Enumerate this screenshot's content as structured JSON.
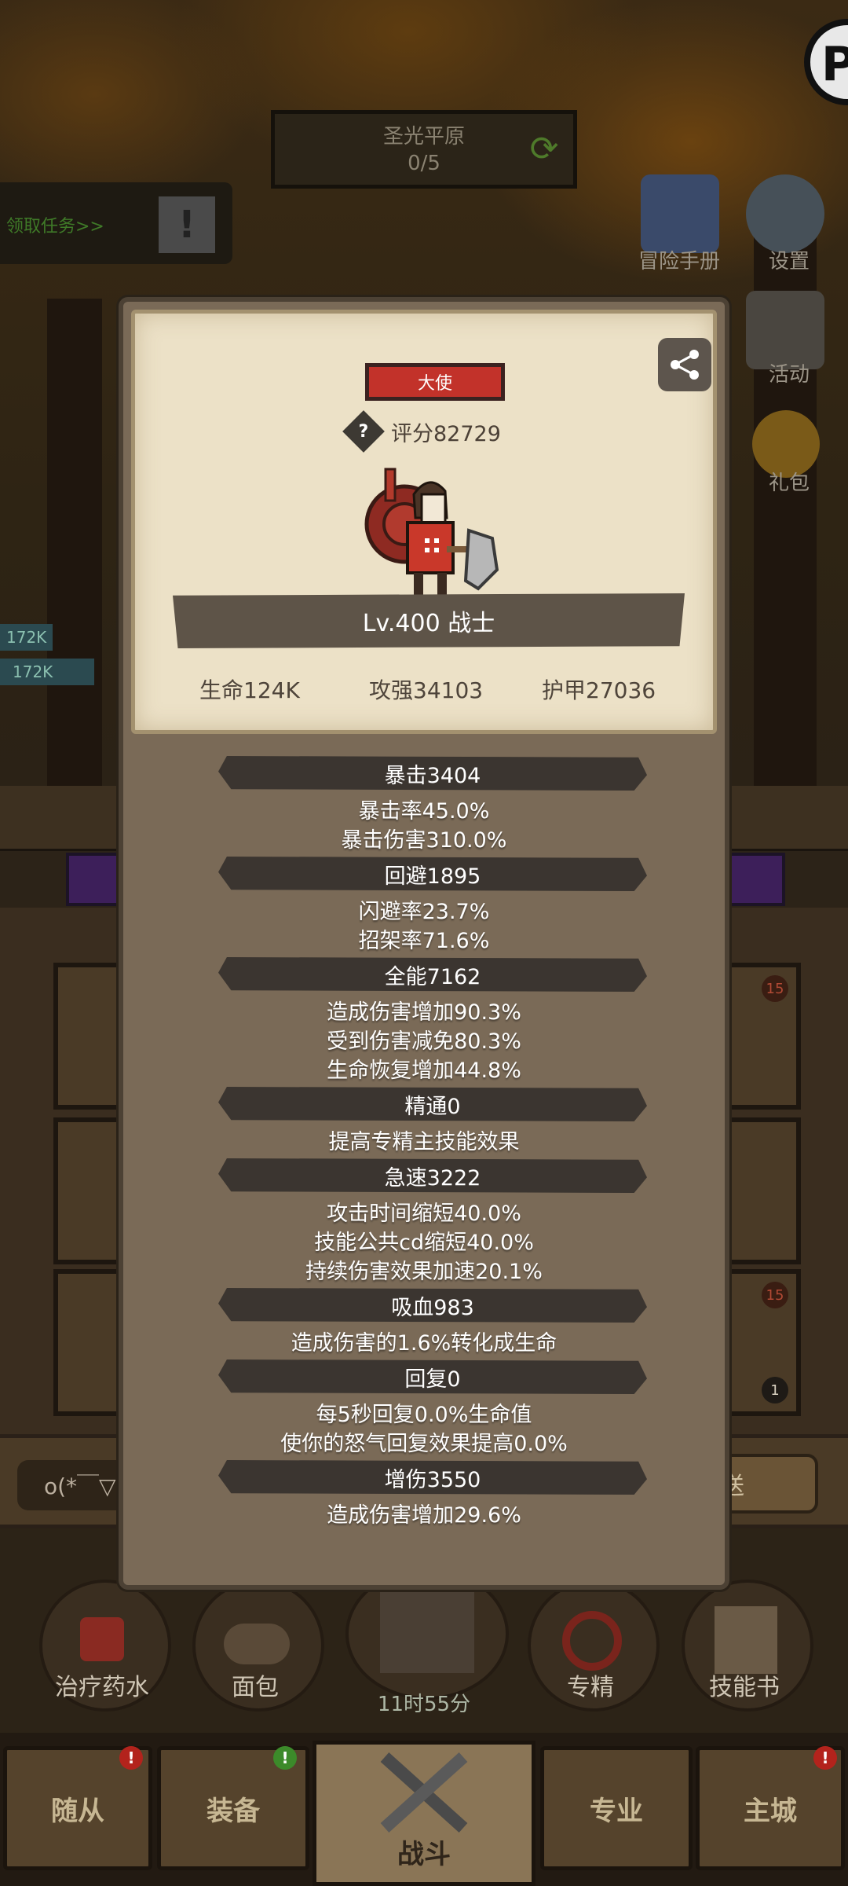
{
  "hud": {
    "zone_name": "圣光平原",
    "zone_progress": "0/5",
    "quest_label": "领取任务>>",
    "menu": {
      "adventure_manual": "冒险手册",
      "settings": "设置",
      "activity": "活动",
      "gift": "礼包"
    },
    "hp_tags": [
      "172K",
      "172K"
    ]
  },
  "profile": {
    "title_badge": "大使",
    "score_label": "评分82729",
    "level_class": "Lv.400 战士",
    "stats": {
      "hp": "生命124K",
      "attack": "攻强34103",
      "armor": "护甲27036"
    }
  },
  "details": [
    {
      "header": "暴击3404",
      "lines": [
        "暴击率45.0%",
        "暴击伤害310.0%"
      ]
    },
    {
      "header": "回避1895",
      "lines": [
        "闪避率23.7%",
        "招架率71.6%"
      ]
    },
    {
      "header": "全能7162",
      "lines": [
        "造成伤害增加90.3%",
        "受到伤害减免80.3%",
        "生命恢复增加44.8%"
      ]
    },
    {
      "header": "精通0",
      "lines": [
        "提高专精主技能效果"
      ]
    },
    {
      "header": "急速3222",
      "lines": [
        "攻击时间缩短40.0%",
        "技能公共cd缩短40.0%",
        "持续伤害效果加速20.1%"
      ]
    },
    {
      "header": "吸血983",
      "lines": [
        "造成伤害的1.6%转化成生命"
      ]
    },
    {
      "header": "回复0",
      "lines": [
        "每5秒回复0.0%生命值",
        "使你的怒气回复效果提高0.0%"
      ]
    },
    {
      "header": "增伤3550",
      "lines": [
        "造成伤害增加29.6%"
      ]
    }
  ],
  "chat": {
    "input_text": "o(*￣▽",
    "send_label": "送"
  },
  "slots": {
    "level_badge": "15",
    "count_badge": "1"
  },
  "actions": {
    "potion": "治疗药水",
    "bread": "面包",
    "timer": "11时55分",
    "specialization": "专精",
    "skill_book": "技能书"
  },
  "nav": {
    "followers": "随从",
    "equipment": "装备",
    "battle": "战斗",
    "profession": "专业",
    "main_city": "主城",
    "alert_mark": "!"
  },
  "colors": {
    "panel": "#7a6a57",
    "card": "#ece1c7",
    "badge_red": "#c2322a",
    "section_bar": "#3b3530"
  }
}
